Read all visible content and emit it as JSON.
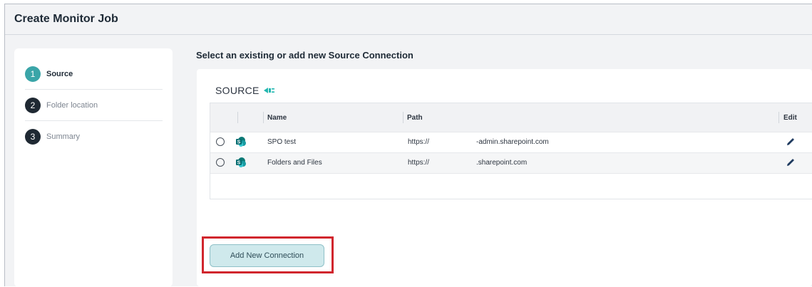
{
  "page": {
    "title": "Create Monitor Job"
  },
  "stepper": {
    "steps": [
      {
        "number": "1",
        "label": "Source",
        "state": "active"
      },
      {
        "number": "2",
        "label": "Folder location",
        "state": "pending"
      },
      {
        "number": "3",
        "label": "Summary",
        "state": "pending"
      }
    ]
  },
  "main": {
    "heading": "Select an existing or add new Source Connection",
    "panel_title": "SOURCE",
    "panel_icon": "plug-icon",
    "table": {
      "columns": [
        "Name",
        "Path",
        "Edit"
      ],
      "rows": [
        {
          "name": "SPO test",
          "path_scheme": "https://",
          "path_host": "-admin.sharepoint.com",
          "icon": "sharepoint-icon"
        },
        {
          "name": "Folders and Files",
          "path_scheme": "https://",
          "path_host": ".sharepoint.com",
          "icon": "sharepoint-icon"
        }
      ]
    },
    "add_button": "Add New Connection"
  },
  "colors": {
    "active_step": "#3aa5a8",
    "pending_step": "#1f2933",
    "highlight_box": "#d1262d",
    "button_bg": "#cfe9ec",
    "sharepoint": "#0b7a76"
  }
}
